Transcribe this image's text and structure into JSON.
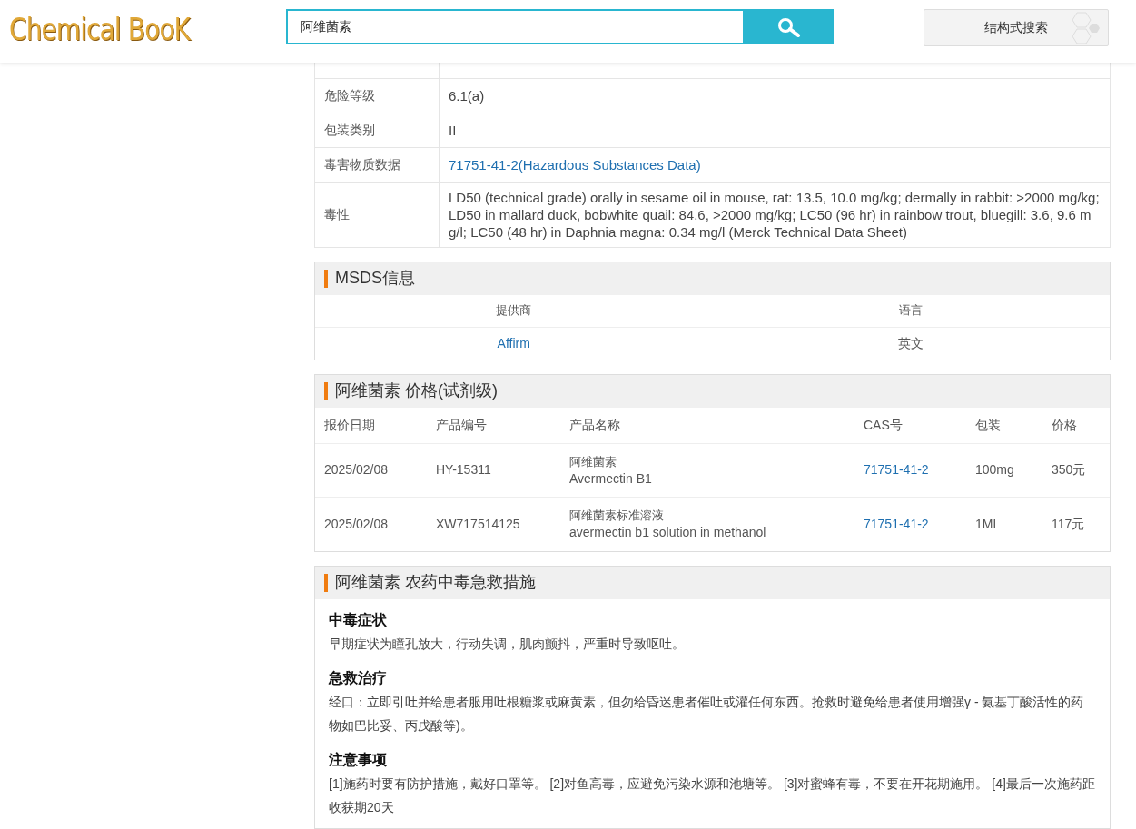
{
  "header": {
    "logo": "Chemical BooK",
    "search": {
      "value": "阿维菌素"
    },
    "structure_search": "结构式搜索"
  },
  "properties": [
    {
      "label": "危险等级",
      "value": "6.1(a)",
      "kind": "text"
    },
    {
      "label": "包装类别",
      "value": "II",
      "kind": "text"
    },
    {
      "label": "毒害物质数据",
      "value": "71751-41-2(Hazardous Substances Data)",
      "kind": "link"
    },
    {
      "label": "毒性",
      "value": "LD50 (technical grade) orally in sesame oil in mouse, rat: 13.5, 10.0 mg/kg; dermally in rabbit: >2000 mg/kg; LD50 in mallard duck, bobwhite quail: 84.6, >2000 mg/kg; LC50 (96 hr) in rainbow trout, bluegill: 3.6, 9.6 mg/l; LC50 (48 hr) in Daphnia magna: 0.34 mg/l (Merck Technical Data Sheet)",
      "kind": "text"
    }
  ],
  "msds": {
    "title": "MSDS信息",
    "columns": [
      "提供商",
      "语言"
    ],
    "rows": [
      [
        "Affirm",
        "英文"
      ]
    ]
  },
  "prices": {
    "title": "阿维菌素 价格(试剂级)",
    "columns": [
      "报价日期",
      "产品编号",
      "产品名称",
      "CAS号",
      "包装",
      "价格"
    ],
    "rows": [
      {
        "date": "2025/02/08",
        "code": "HY-15311",
        "name_cn": "阿维菌素",
        "name_en": "Avermectin B1",
        "cas": "71751-41-2",
        "pack": "100mg",
        "price": "350元"
      },
      {
        "date": "2025/02/08",
        "code": "XW717514125",
        "name_cn": "阿维菌素标准溶液",
        "name_en": "avermectin b1 solution in methanol",
        "cas": "71751-41-2",
        "pack": "1ML",
        "price": "117元"
      }
    ]
  },
  "first_aid": {
    "title": "阿维菌素 农药中毒急救措施",
    "sections": [
      {
        "heading": "中毒症状",
        "text": "早期症状为瞳孔放大，行动失调，肌肉颤抖，严重时导致呕吐。"
      },
      {
        "heading": "急救治疗",
        "text": "经口：立即引吐并给患者服用吐根糖浆或麻黄素，但勿给昏迷患者催吐或灌任何东西。抢救时避免给患者使用增强γ - 氨基丁酸活性的药物如巴比妥、丙戊酸等)。"
      },
      {
        "heading": "注意事项",
        "text": "[1]施药时要有防护措施，戴好口罩等。 [2]对鱼高毒，应避免污染水源和池塘等。 [3]对蜜蜂有毒，不要在开花期施用。 [4]最后一次施药距收获期20天"
      }
    ]
  }
}
